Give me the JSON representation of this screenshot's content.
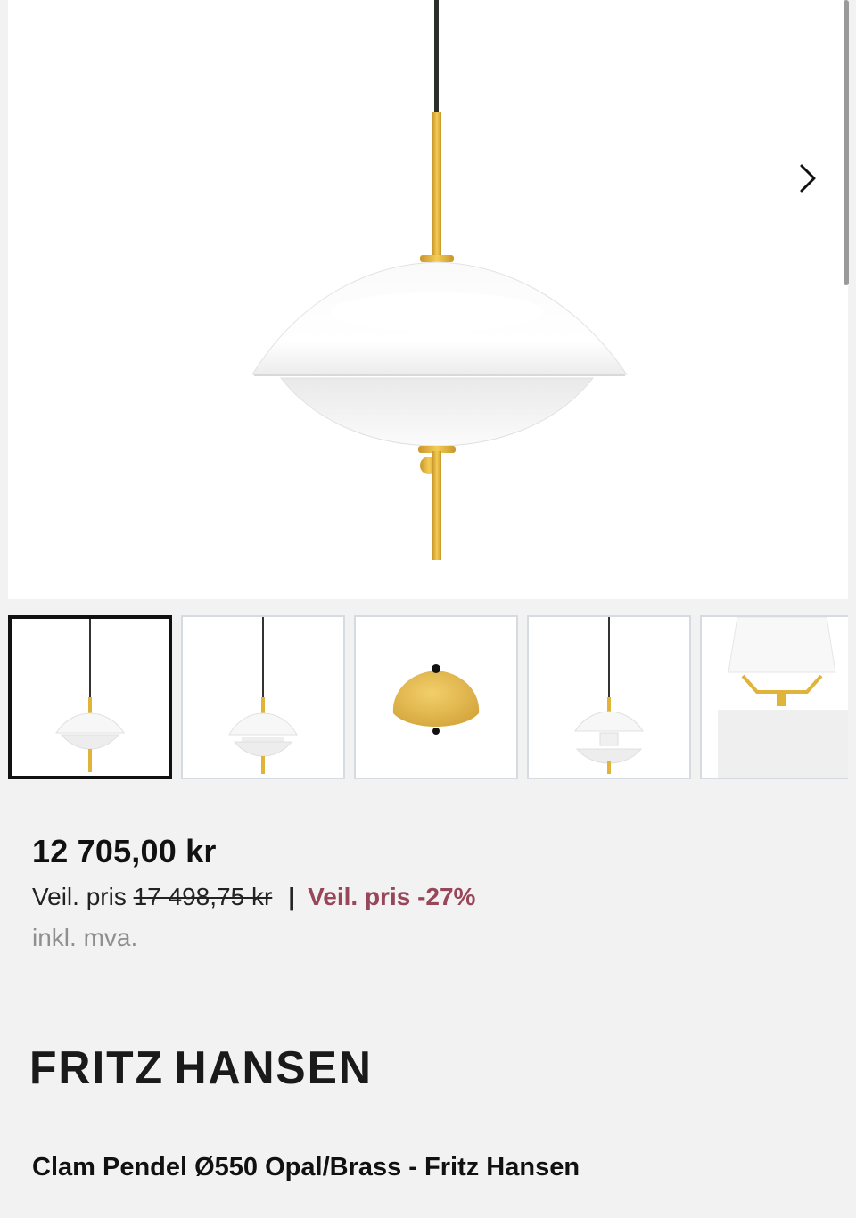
{
  "gallery": {
    "next_icon": "chevron-right-icon",
    "thumbnails": [
      {
        "label": "thumbnail-1",
        "active": true
      },
      {
        "label": "thumbnail-2",
        "active": false
      },
      {
        "label": "thumbnail-3",
        "active": false
      },
      {
        "label": "thumbnail-4",
        "active": false
      },
      {
        "label": "thumbnail-5",
        "active": false
      }
    ]
  },
  "product": {
    "price": "12 705,00 kr",
    "veil_label": "Veil. pris",
    "veil_price": "17 498,75 kr",
    "separator": "|",
    "discount": "Veil. pris -27%",
    "vat_note": "inkl. mva.",
    "brand_word1": "FRITZ",
    "brand_word2": "HANSEN",
    "title": "Clam Pendel Ø550 Opal/Brass - Fritz Hansen"
  },
  "colors": {
    "discount": "#98465a",
    "brass": "#e0b43a",
    "active_border": "#111111",
    "thumb_border": "#d6dbe2"
  }
}
